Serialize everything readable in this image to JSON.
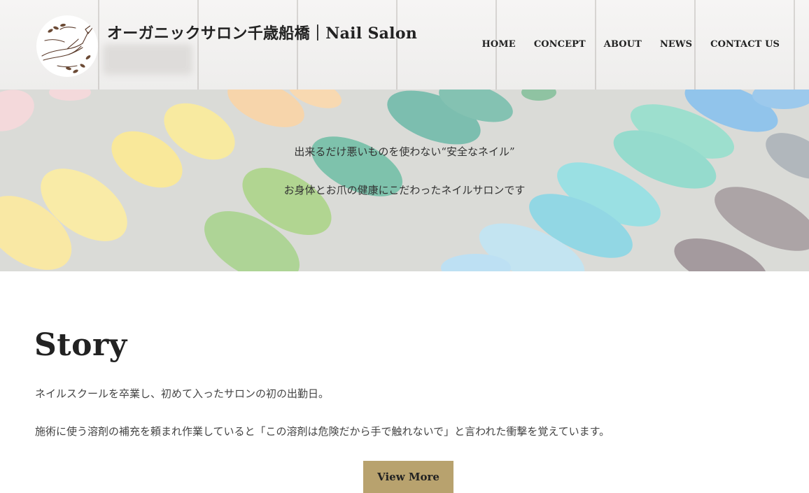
{
  "header": {
    "site_title": "オーガニックサロン千歳船橋｜Nail Salon"
  },
  "nav": {
    "items": [
      {
        "label": "HOME"
      },
      {
        "label": "CONCEPT"
      },
      {
        "label": "ABOUT"
      },
      {
        "label": "NEWS"
      },
      {
        "label": "CONTACT US"
      }
    ]
  },
  "hero": {
    "line1": "出来るだけ悪いものを使わない“安全なネイル”",
    "line2": "お身体とお爪の健康にこだわったネイルサロンです"
  },
  "story": {
    "heading": "Story",
    "paragraph1": "ネイルスクールを卒業し、初めて入ったサロンの初の出勤日。",
    "paragraph2": "施術に使う溶剤の補充を頼まれ作業していると「この溶剤は危険だから手で触れないで」と言われた衝撃を覚えています。",
    "button_label": "View More"
  },
  "colors": {
    "button_bg": "#b8a26e",
    "text": "#222222"
  },
  "icons": [
    "logo-hand-illustration"
  ]
}
